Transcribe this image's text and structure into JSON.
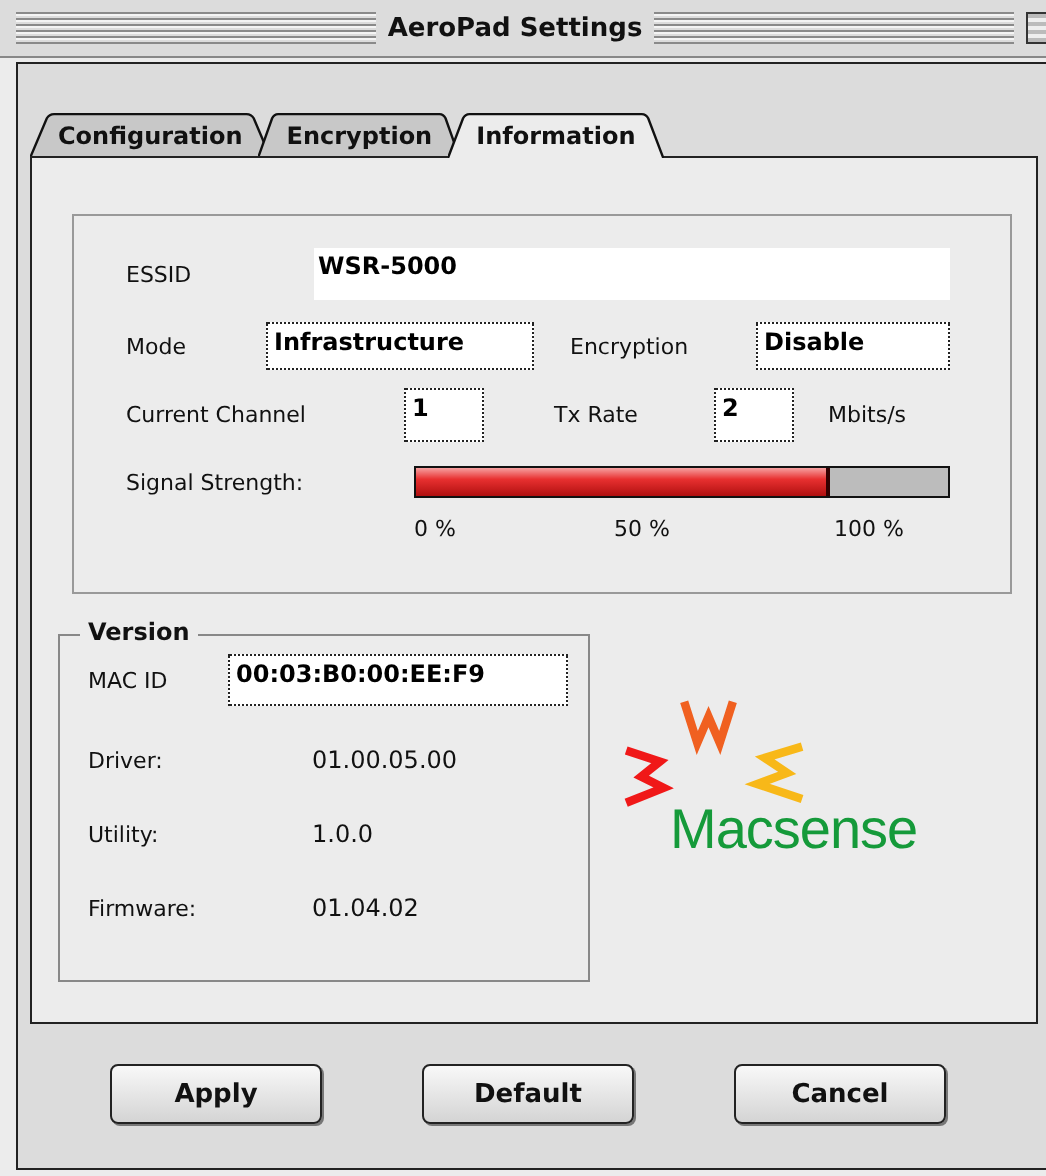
{
  "window": {
    "title": "AeroPad Settings"
  },
  "tabs": [
    {
      "label": "Configuration",
      "selected": false
    },
    {
      "label": "Encryption",
      "selected": false
    },
    {
      "label": "Information",
      "selected": true
    }
  ],
  "network": {
    "essid": {
      "label": "ESSID",
      "value": "WSR-5000"
    },
    "mode": {
      "label": "Mode",
      "value": "Infrastructure"
    },
    "encryption": {
      "label": "Encryption",
      "value": "Disable"
    },
    "channel": {
      "label": "Current Channel",
      "value": "1"
    },
    "tx_rate": {
      "label": "Tx Rate",
      "value": "2",
      "unit": "Mbits/s"
    },
    "signal": {
      "label": "Signal Strength:",
      "level": 0.78,
      "scale": [
        "0 %",
        "50 %",
        "100 %"
      ]
    }
  },
  "version": {
    "title": "Version",
    "mac_id": {
      "label": "MAC ID",
      "value": "00:03:B0:00:EE:F9"
    },
    "rows": [
      {
        "label": "Driver:",
        "value": "01.00.05.00"
      },
      {
        "label": "Utility:",
        "value": "1.0.0"
      },
      {
        "label": "Firmware:",
        "value": "01.04.02"
      }
    ]
  },
  "logo": {
    "text": "Macsense"
  },
  "buttons": [
    "Apply",
    "Default",
    "Cancel"
  ]
}
